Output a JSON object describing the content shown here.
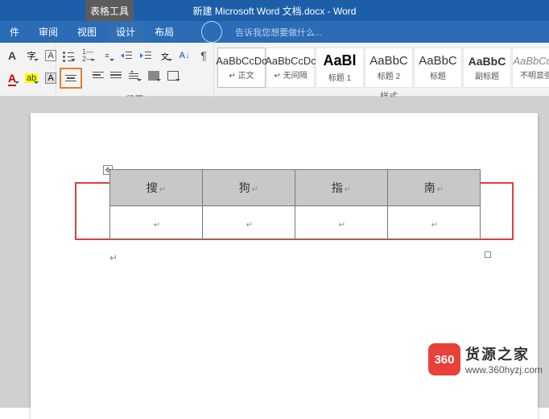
{
  "title": "新建 Microsoft Word 文档.docx - Word",
  "table_tools": "表格工具",
  "menu": {
    "file": "件",
    "review": "审阅",
    "view": "视图",
    "design": "设计",
    "layout": "布局"
  },
  "tellme": "告诉我您想要做什么...",
  "groups": {
    "paragraph": "段落",
    "styles": "样式"
  },
  "styles": [
    {
      "sample": "AaBbCcDc",
      "name": "↵ 正文"
    },
    {
      "sample": "AaBbCcDc",
      "name": "↵ 无间隔"
    },
    {
      "sample": "AaBl",
      "name": "标题 1",
      "cls": "h1"
    },
    {
      "sample": "AaBbC",
      "name": "标题 2",
      "cls": "h2"
    },
    {
      "sample": "AaBbC",
      "name": "标题",
      "cls": "t"
    },
    {
      "sample": "AaBbC",
      "name": "副标题",
      "cls": "sub"
    },
    {
      "sample": "AaBbCcD",
      "name": "不明显强",
      "cls": "em"
    }
  ],
  "table_cells": [
    "搜",
    "狗",
    "指",
    "南"
  ],
  "watermark": {
    "badge": "360",
    "title": "货源之家",
    "url": "www.360hyzj.com"
  }
}
